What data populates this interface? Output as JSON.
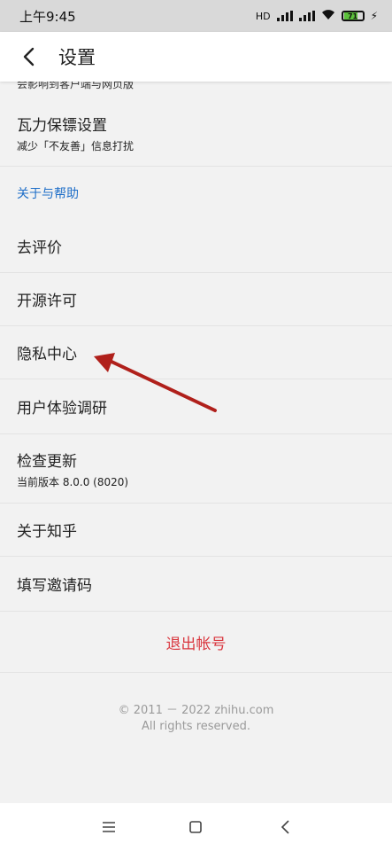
{
  "status_bar": {
    "time": "上午9:45",
    "network": "HD",
    "battery": "71"
  },
  "header": {
    "title": "设置"
  },
  "settings": {
    "partial_subtitle": "会影响到客户端与网页版",
    "sections": [
      {
        "label": "瓦力保镖设置",
        "sub": "减少「不友善」信息打扰"
      }
    ],
    "about_header": "关于与帮助",
    "about_items": [
      {
        "label": "去评价"
      },
      {
        "label": "开源许可"
      },
      {
        "label": "隐私中心"
      },
      {
        "label": "用户体验调研"
      },
      {
        "label": "检查更新",
        "sub": "当前版本 8.0.0 (8020)"
      },
      {
        "label": "关于知乎"
      },
      {
        "label": "填写邀请码"
      }
    ],
    "logout": "退出帐号"
  },
  "footer": {
    "line1": "© 2011 － 2022 zhihu.com",
    "line2": "All rights reserved."
  },
  "nav_bar": {
    "icons": [
      "menu-icon",
      "home-icon",
      "back-icon"
    ]
  },
  "colors": {
    "accent": "#1e6ec8",
    "danger": "#d9363e",
    "arrow": "#b0201b"
  }
}
